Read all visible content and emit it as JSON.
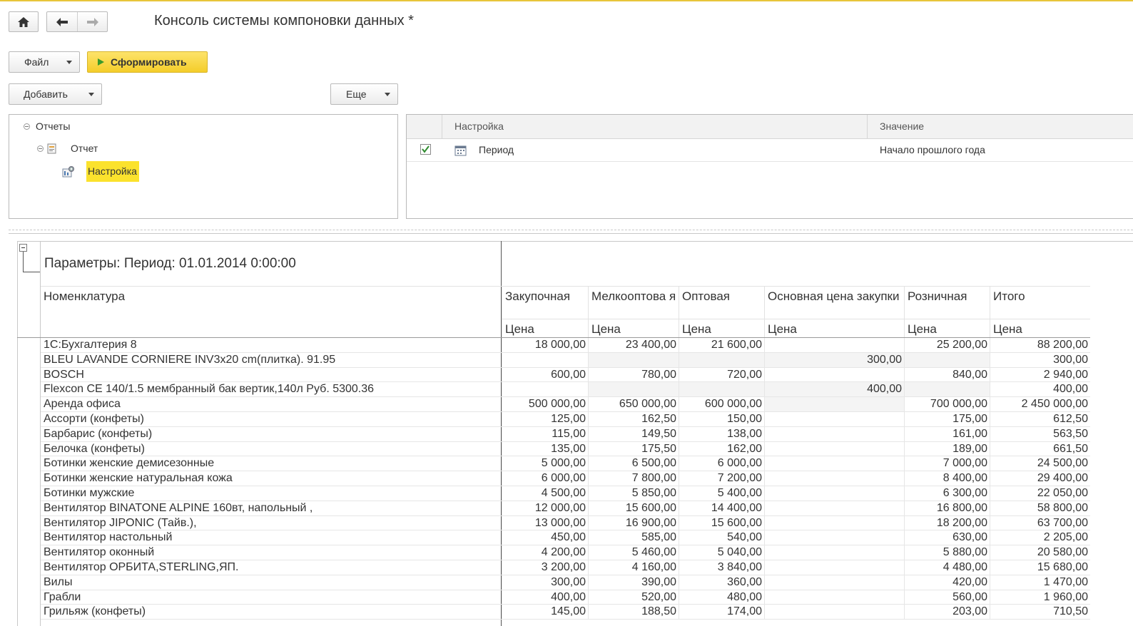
{
  "window": {
    "title": "Консоль системы компоновки данных *"
  },
  "toolbar": {
    "home_icon": "home-icon",
    "back_icon": "arrow-left-icon",
    "forward_icon": "arrow-right-icon",
    "file_label": "Файл",
    "generate_label": "Сформировать",
    "add_label": "Добавить",
    "more_label": "Еще"
  },
  "tree": {
    "root": "Отчеты",
    "report": "Отчет",
    "setting": "Настройка"
  },
  "settings": {
    "col_setting": "Настройка",
    "col_value": "Значение",
    "row": {
      "name": "Период",
      "value": "Начало прошлого года",
      "checked": true
    }
  },
  "report": {
    "params_line": "Параметры: Период: 01.01.2014 0:00:00",
    "headers": [
      "Номенклатура",
      "Закупочная",
      "Мелкооптова я",
      "Оптовая",
      "Основная цена закупки",
      "Розничная",
      "Итого"
    ],
    "subheader": "Цена",
    "rows": [
      [
        "1С:Бухгалтерия 8",
        "18 000,00",
        "23 400,00",
        "21 600,00",
        "",
        "25 200,00",
        "88 200,00"
      ],
      [
        "BLEU  LAVANDE CORNIERE  INV3x20 cm(плитка).            91.95",
        "",
        "",
        "",
        "300,00",
        "",
        "300,00"
      ],
      [
        "BOSCH",
        "600,00",
        "780,00",
        "720,00",
        "",
        "840,00",
        "2 940,00"
      ],
      [
        "Flexcon CE 140/1.5 мембранный бак вертик,140л Руб.         5300.36",
        "",
        "",
        "",
        "400,00",
        "",
        "400,00"
      ],
      [
        "Аренда офиса",
        "500 000,00",
        "650 000,00",
        "600 000,00",
        "",
        "700 000,00",
        "2 450 000,00"
      ],
      [
        "Ассорти (конфеты)",
        "125,00",
        "162,50",
        "150,00",
        "",
        "175,00",
        "612,50"
      ],
      [
        "Барбарис (конфеты)",
        "115,00",
        "149,50",
        "138,00",
        "",
        "161,00",
        "563,50"
      ],
      [
        "Белочка (конфеты)",
        "135,00",
        "175,50",
        "162,00",
        "",
        "189,00",
        "661,50"
      ],
      [
        "Ботинки женские демисезонные",
        "5 000,00",
        "6 500,00",
        "6 000,00",
        "",
        "7 000,00",
        "24 500,00"
      ],
      [
        "Ботинки женские натуральная кожа",
        "6 000,00",
        "7 800,00",
        "7 200,00",
        "",
        "8 400,00",
        "29 400,00"
      ],
      [
        "Ботинки мужские",
        "4 500,00",
        "5 850,00",
        "5 400,00",
        "",
        "6 300,00",
        "22 050,00"
      ],
      [
        "Вентилятор BINATONE ALPINE 160вт, напольный ,",
        "12 000,00",
        "15 600,00",
        "14 400,00",
        "",
        "16 800,00",
        "58 800,00"
      ],
      [
        "Вентилятор JIPONIC (Тайв.),",
        "13 000,00",
        "16 900,00",
        "15 600,00",
        "",
        "18 200,00",
        "63 700,00"
      ],
      [
        "Вентилятор настольный",
        "450,00",
        "585,00",
        "540,00",
        "",
        "630,00",
        "2 205,00"
      ],
      [
        "Вентилятор оконный",
        "4 200,00",
        "5 460,00",
        "5 040,00",
        "",
        "5 880,00",
        "20 580,00"
      ],
      [
        "Вентилятор ОРБИТА,STERLING,ЯП.",
        "3 200,00",
        "4 160,00",
        "3 840,00",
        "",
        "4 480,00",
        "15 680,00"
      ],
      [
        "Вилы",
        "300,00",
        "390,00",
        "360,00",
        "",
        "420,00",
        "1 470,00"
      ],
      [
        "Грабли",
        "400,00",
        "520,00",
        "480,00",
        "",
        "560,00",
        "1 960,00"
      ],
      [
        "Грильяж (конфеты)",
        "145,00",
        "188,50",
        "174,00",
        "",
        "203,00",
        "710,50"
      ]
    ]
  }
}
